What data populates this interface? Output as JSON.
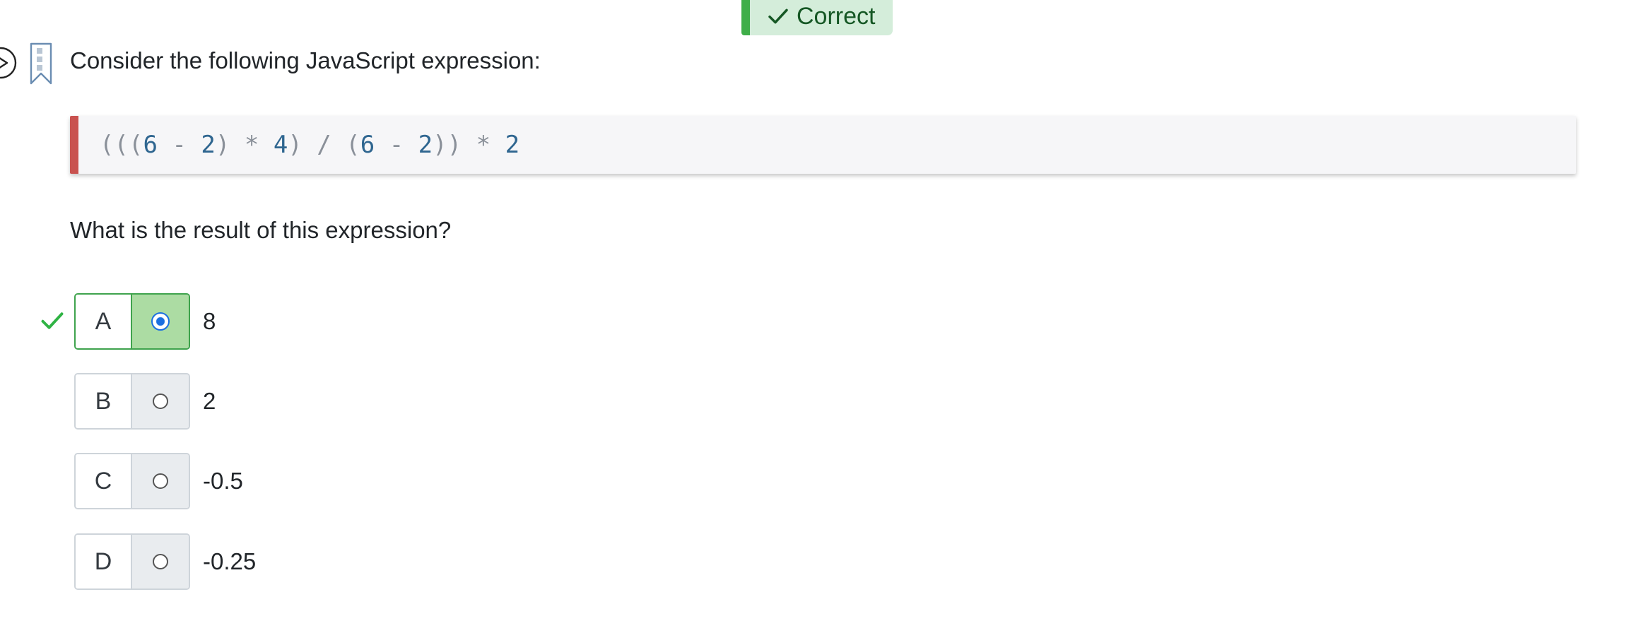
{
  "status": {
    "icon": "check-icon",
    "label": "Correct",
    "color": "#3fae49"
  },
  "question": {
    "intro": "Consider the following JavaScript expression:",
    "code": "(((6 - 2) * 4) / (6 - 2)) * 2",
    "prompt": "What is the result of this expression?"
  },
  "options": [
    {
      "letter": "A",
      "value": "8",
      "selected": true,
      "correct": true
    },
    {
      "letter": "B",
      "value": "2",
      "selected": false
    },
    {
      "letter": "C",
      "value": "-0.5",
      "selected": false
    },
    {
      "letter": "D",
      "value": "-0.25",
      "selected": false
    }
  ],
  "colors": {
    "accent": "#1a6fe0",
    "correct": "#3fa34d",
    "code_border": "#c9524f"
  }
}
